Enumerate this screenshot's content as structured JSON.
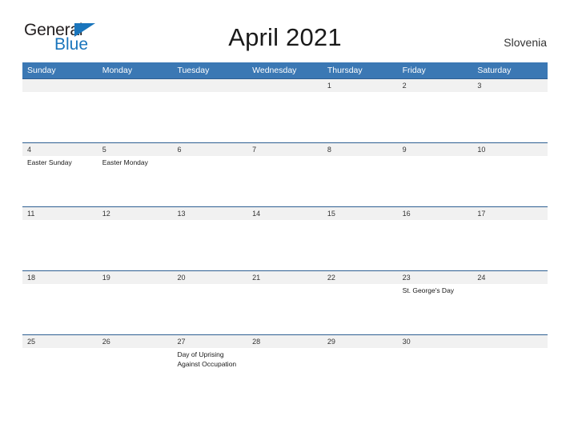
{
  "brand": {
    "word_one": "General",
    "word_two": "Blue",
    "triangle_icon": "triangle-icon",
    "color_dark": "#231f20",
    "color_blue": "#1a75bc"
  },
  "header": {
    "title": "April 2021",
    "region": "Slovenia"
  },
  "theme": {
    "header_blue": "#3b78b4",
    "row_rule": "#2e5f92",
    "date_band": "#f1f1f1"
  },
  "calendar": {
    "weekdays": [
      "Sunday",
      "Monday",
      "Tuesday",
      "Wednesday",
      "Thursday",
      "Friday",
      "Saturday"
    ],
    "weeks": [
      {
        "days": [
          {
            "date": "",
            "event": ""
          },
          {
            "date": "",
            "event": ""
          },
          {
            "date": "",
            "event": ""
          },
          {
            "date": "",
            "event": ""
          },
          {
            "date": "1",
            "event": ""
          },
          {
            "date": "2",
            "event": ""
          },
          {
            "date": "3",
            "event": ""
          }
        ]
      },
      {
        "days": [
          {
            "date": "4",
            "event": "Easter Sunday"
          },
          {
            "date": "5",
            "event": "Easter Monday"
          },
          {
            "date": "6",
            "event": ""
          },
          {
            "date": "7",
            "event": ""
          },
          {
            "date": "8",
            "event": ""
          },
          {
            "date": "9",
            "event": ""
          },
          {
            "date": "10",
            "event": ""
          }
        ]
      },
      {
        "days": [
          {
            "date": "11",
            "event": ""
          },
          {
            "date": "12",
            "event": ""
          },
          {
            "date": "13",
            "event": ""
          },
          {
            "date": "14",
            "event": ""
          },
          {
            "date": "15",
            "event": ""
          },
          {
            "date": "16",
            "event": ""
          },
          {
            "date": "17",
            "event": ""
          }
        ]
      },
      {
        "days": [
          {
            "date": "18",
            "event": ""
          },
          {
            "date": "19",
            "event": ""
          },
          {
            "date": "20",
            "event": ""
          },
          {
            "date": "21",
            "event": ""
          },
          {
            "date": "22",
            "event": ""
          },
          {
            "date": "23",
            "event": "St. George's Day"
          },
          {
            "date": "24",
            "event": ""
          }
        ]
      },
      {
        "days": [
          {
            "date": "25",
            "event": ""
          },
          {
            "date": "26",
            "event": ""
          },
          {
            "date": "27",
            "event": "Day of Uprising\nAgainst Occupation"
          },
          {
            "date": "28",
            "event": ""
          },
          {
            "date": "29",
            "event": ""
          },
          {
            "date": "30",
            "event": ""
          },
          {
            "date": "",
            "event": ""
          }
        ]
      }
    ]
  }
}
